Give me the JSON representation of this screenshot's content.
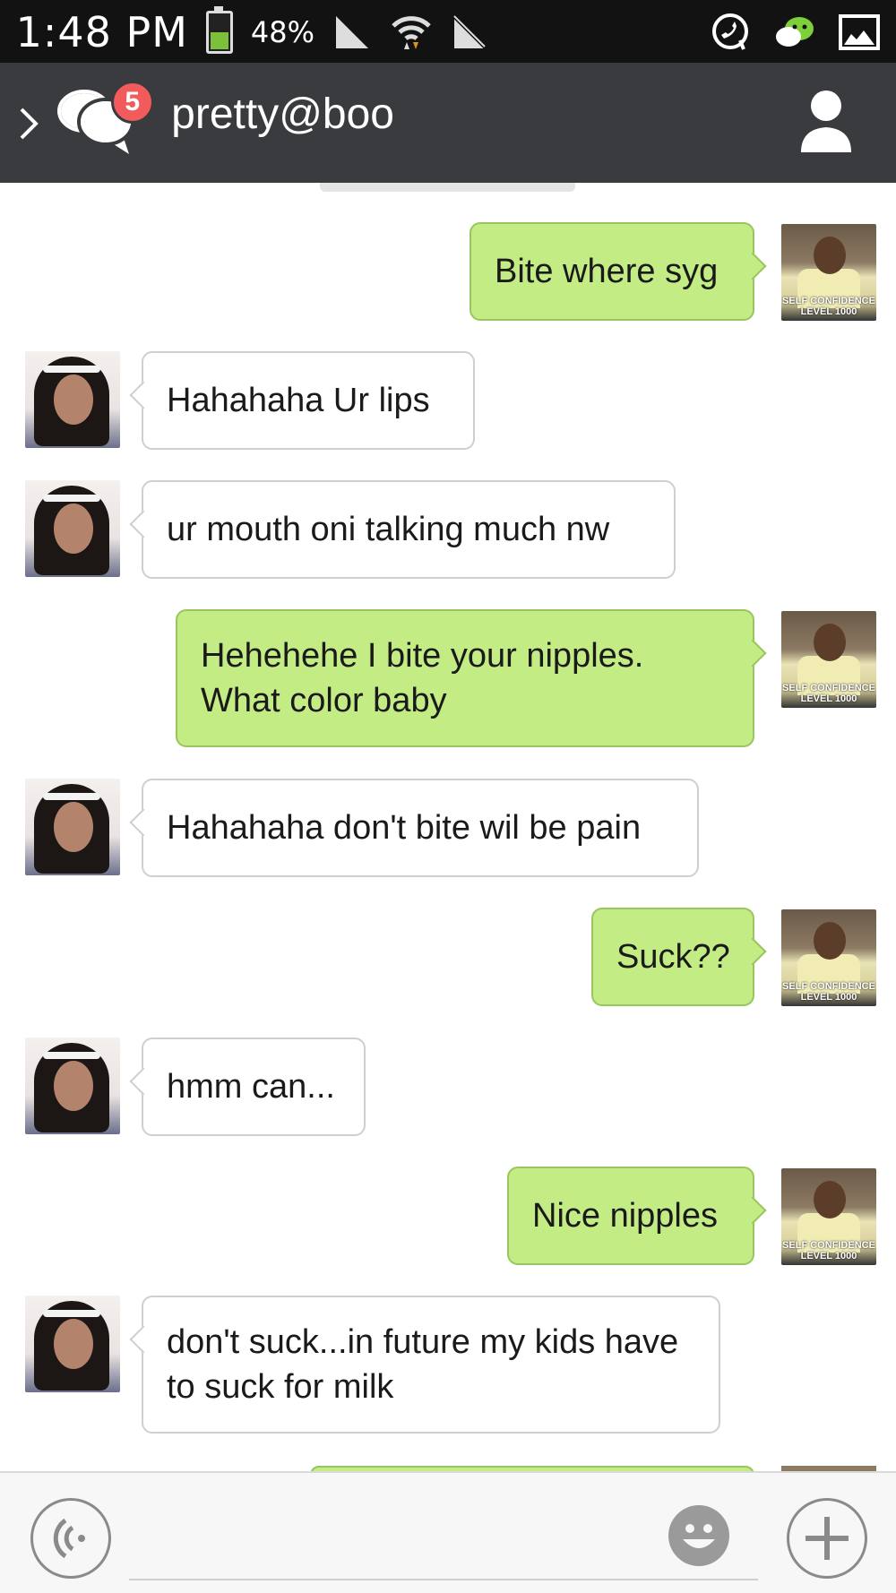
{
  "status_bar": {
    "time": "1:48 PM",
    "battery_percent": "48%",
    "battery_level": 0.48
  },
  "header": {
    "contact_name": "pretty@boo",
    "unread_count": "5"
  },
  "messages": [
    {
      "side": "right",
      "sender": "me",
      "text": "Bite where syg"
    },
    {
      "side": "left",
      "sender": "contact",
      "text": "Hahahaha Ur lips"
    },
    {
      "side": "left",
      "sender": "contact",
      "text": "ur mouth oni talking much nw"
    },
    {
      "side": "right",
      "sender": "me",
      "text": "Hehehehe I bite your nipples.\nWhat color baby"
    },
    {
      "side": "left",
      "sender": "contact",
      "text": "Hahahaha don't bite wil be pain"
    },
    {
      "side": "right",
      "sender": "me",
      "text": "Suck??"
    },
    {
      "side": "left",
      "sender": "contact",
      "text": "hmm can..."
    },
    {
      "side": "right",
      "sender": "me",
      "text": "Nice nipples"
    },
    {
      "side": "left",
      "sender": "contact",
      "text": "don't suck...in future my kids have\nto suck for milk"
    }
  ],
  "avatars": {
    "me_caption": "SELF CONFIDENCE LEVEL 1000"
  },
  "icons": {
    "back": "chevron-left-icon",
    "chats": "chat-bubbles-icon",
    "profile": "person-icon",
    "plus": "plus-icon",
    "emoji": "smiley-icon",
    "voice": "voice-icon"
  },
  "colors": {
    "status_bar": "#121212",
    "app_bar": "#393b3f",
    "my_bubble": "#c3ec84",
    "their_bubble": "#ffffff",
    "badge": "#f25b5b",
    "battery_fill": "#7dc13a"
  }
}
